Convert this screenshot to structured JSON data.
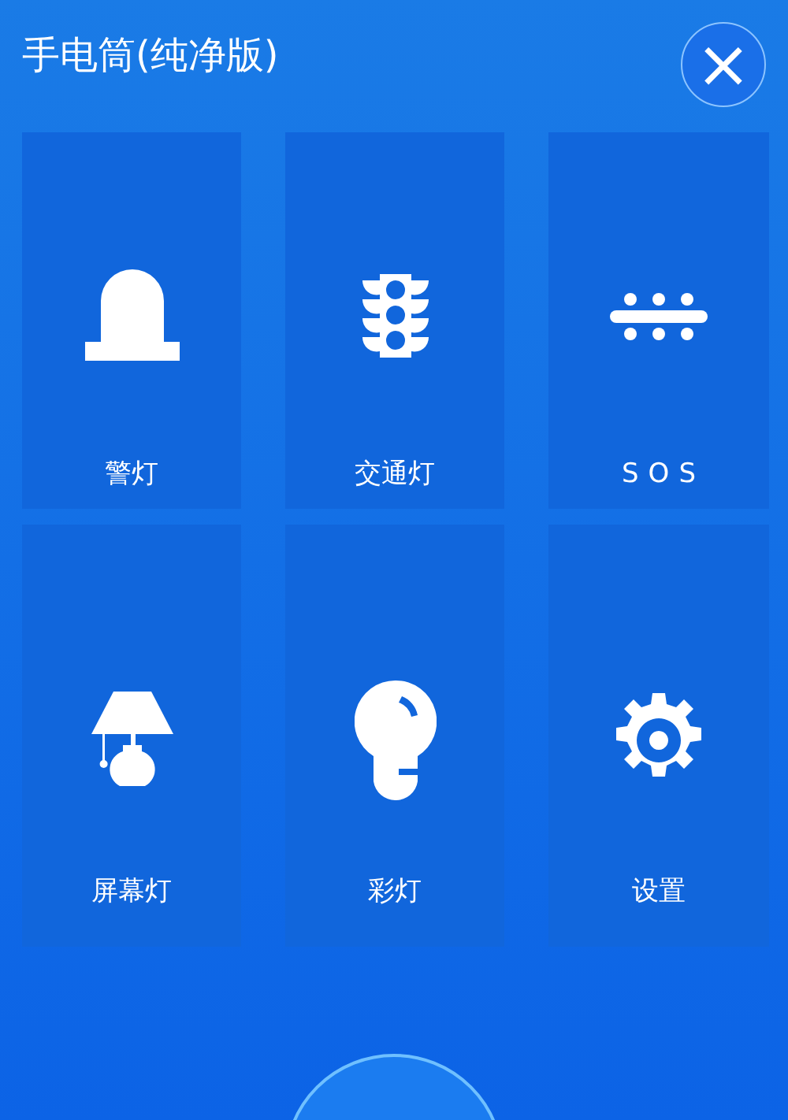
{
  "title": "手电筒(纯净版)",
  "close_button": {
    "label": "×"
  },
  "tiles": [
    {
      "kind": "beacon",
      "label": "警灯"
    },
    {
      "kind": "traffic",
      "label": "交通灯"
    },
    {
      "kind": "sos",
      "label": "SOS"
    },
    {
      "kind": "lamp",
      "label": "屏幕灯"
    },
    {
      "kind": "bulb",
      "label": "彩灯"
    },
    {
      "kind": "gear",
      "label": "设置"
    }
  ],
  "power_button": {
    "kind": "circle"
  }
}
